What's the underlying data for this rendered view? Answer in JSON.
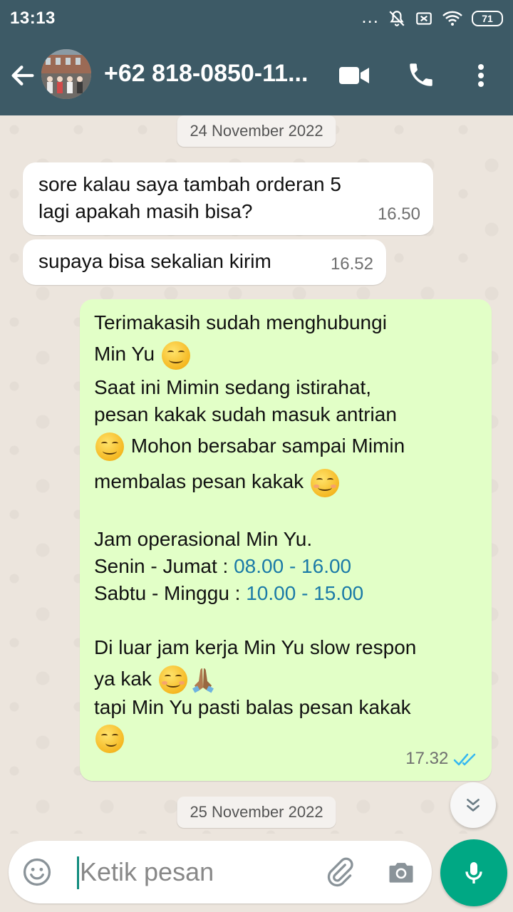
{
  "status_bar": {
    "time": "13:13",
    "dots": "...",
    "battery": "71"
  },
  "header": {
    "contact": "+62 818-0850-11..."
  },
  "messages": {
    "date1": "24 November 2022",
    "m1": {
      "line1": "sore kalau saya tambah orderan 5",
      "line2": "lagi apakah masih bisa?",
      "time": "16.50"
    },
    "m2": {
      "text": "supaya bisa sekalian kirim",
      "time": "16.52"
    },
    "m3": {
      "l1": "Terimakasih sudah menghubungi",
      "l2": "Min Yu",
      "l3": "Saat ini Mimin sedang istirahat,",
      "l4": "pesan kakak sudah masuk antrian",
      "l5": "Mohon bersabar sampai Mimin",
      "l6": "membalas pesan kakak",
      "l7": "Jam operasional Min Yu.",
      "l8_label": "Senin - Jumat : ",
      "l8_hours": "08.00 - 16.00",
      "l9_label": "Sabtu - Minggu : ",
      "l9_hours": "10.00 - 15.00",
      "l10": "Di luar jam kerja Min Yu slow respon",
      "l11": "ya kak",
      "l12": "tapi Min Yu pasti balas pesan kakak",
      "time": "17.32"
    },
    "date2": "25 November 2022"
  },
  "input": {
    "placeholder": "Ketik pesan"
  },
  "colors": {
    "header": "#3d5a66",
    "chat_bg": "#ece5dd",
    "outgoing": "#e2ffc7",
    "accent": "#00a884",
    "link": "#1a7aa7",
    "read_ticks": "#34b7f1"
  },
  "icons": [
    "back-arrow-icon",
    "video-call-icon",
    "phone-icon",
    "more-vert-icon",
    "emoji-icon",
    "attach-icon",
    "camera-icon",
    "mic-icon",
    "scroll-down-icon",
    "double-check-icon"
  ]
}
